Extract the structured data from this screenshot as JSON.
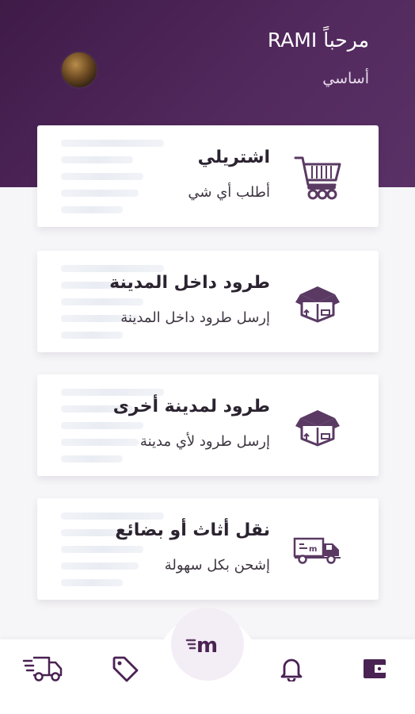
{
  "header": {
    "greeting": "مرحباً RAMI",
    "plan": "أساسي"
  },
  "cards": [
    {
      "title": "اشتريلي",
      "subtitle": "أطلب أي شي",
      "icon": "shopping-cart-icon"
    },
    {
      "title": "طرود داخل المدينة",
      "subtitle": "إرسل طرود داخل المدينة",
      "icon": "box-icon"
    },
    {
      "title": "طرود لمدينة أخرى",
      "subtitle": "إرسل طرود لأي مدينة",
      "icon": "box-icon"
    },
    {
      "title": "نقل أثاث أو بضائع",
      "subtitle": "إشحن بكل سهولة",
      "icon": "moving-truck-icon"
    }
  ],
  "bottom_nav": {
    "center_logo": "m",
    "items": [
      "delivery-truck-icon",
      "tag-icon",
      "bell-icon",
      "wallet-icon"
    ]
  },
  "colors": {
    "brand_purple": "#4a2253",
    "icon_purple": "#5a3a63"
  }
}
